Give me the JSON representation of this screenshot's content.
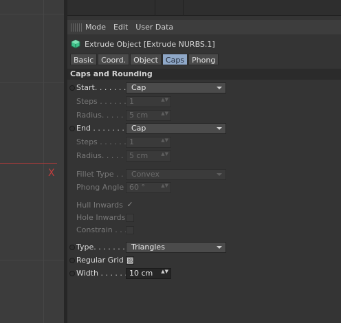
{
  "viewport": {
    "axis_label": "X",
    "axis_color": "#c13d3d"
  },
  "menu": {
    "items": [
      "Mode",
      "Edit",
      "User Data"
    ]
  },
  "object": {
    "title": "Extrude Object [Extrude NURBS.1]",
    "icon": "extrude-object-icon",
    "icon_color": "#3fc08a"
  },
  "tabs": [
    {
      "label": "Basic",
      "active": false
    },
    {
      "label": "Coord.",
      "active": false
    },
    {
      "label": "Object",
      "active": false
    },
    {
      "label": "Caps",
      "active": true
    },
    {
      "label": "Phong",
      "active": false
    }
  ],
  "section": {
    "title": "Caps and Rounding"
  },
  "fields": {
    "start": {
      "label": "Start. . . . . . . .",
      "value": "Cap"
    },
    "start_steps": {
      "label": "Steps . . . . . . .",
      "value": "1"
    },
    "start_radius": {
      "label": "Radius. . . . . .",
      "value": "5 cm"
    },
    "end": {
      "label": "End . . . . . . . .",
      "value": "Cap"
    },
    "end_steps": {
      "label": "Steps . . . . . . .",
      "value": "1"
    },
    "end_radius": {
      "label": "Radius. . . . . .",
      "value": "5 cm"
    },
    "fillet_type": {
      "label": "Fillet Type . . .",
      "value": "Convex"
    },
    "phong_angle": {
      "label": "Phong Angle",
      "value": "60 °"
    },
    "hull_inwards": {
      "label": "Hull Inwards",
      "checked": true
    },
    "hole_inwards": {
      "label": "Hole Inwards",
      "checked": false
    },
    "constrain": {
      "label": "Constrain . . .",
      "checked": false
    },
    "type": {
      "label": "Type. . . . . . . .",
      "value": "Triangles"
    },
    "regular_grid": {
      "label": "Regular Grid",
      "checked": true,
      "mark": "▨"
    },
    "width": {
      "label": "Width . . . . . .",
      "value": "10 cm"
    }
  },
  "glyphs": {
    "check_mark": "✓",
    "spin": "▲▼"
  }
}
